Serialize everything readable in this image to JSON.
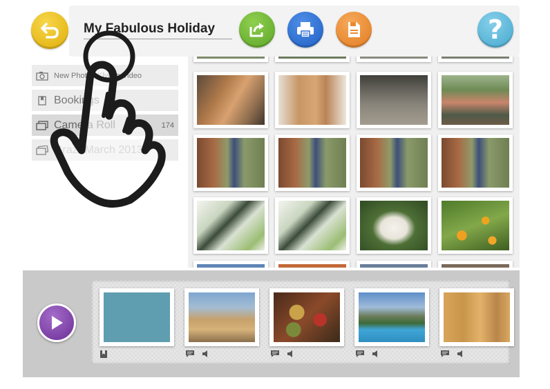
{
  "header": {
    "title": "My Fabulous Holiday"
  },
  "sidebar": {
    "items": [
      {
        "label": "New Photo / Klynka Video",
        "icon": "camera-icon"
      },
      {
        "label": "Bookings",
        "icon": "bookmark-icon"
      },
      {
        "label": "Camera Roll",
        "count": "174",
        "icon": "photos-icon",
        "selected": true
      },
      {
        "label": "Graz- March 2013",
        "icon": "album-icon"
      }
    ]
  },
  "photos": [
    {
      "subject": "orange cat"
    },
    {
      "subject": "orange cat close-up"
    },
    {
      "subject": "cat lying on patio"
    },
    {
      "subject": "group of friends"
    },
    {
      "subject": "woman by tree"
    },
    {
      "subject": "woman by tree"
    },
    {
      "subject": "woman by tree"
    },
    {
      "subject": "woman by tree"
    },
    {
      "subject": "building sketch"
    },
    {
      "subject": "building sketch"
    },
    {
      "subject": "white goat"
    },
    {
      "subject": "orange tree"
    }
  ],
  "storyboard": {
    "cards": [
      {
        "subject": "blank page",
        "icons": [
          "bookmark-icon"
        ]
      },
      {
        "subject": "coastal town",
        "icons": [
          "caption-icon",
          "audio-icon"
        ]
      },
      {
        "subject": "market food",
        "icons": [
          "caption-icon",
          "audio-icon"
        ]
      },
      {
        "subject": "swimming pool",
        "icons": [
          "caption-icon",
          "audio-icon"
        ]
      },
      {
        "subject": "yellow buildings",
        "icons": [
          "caption-icon",
          "audio-icon"
        ]
      }
    ]
  },
  "colors": {
    "back": "#e7bb16",
    "share": "#6cb531",
    "print": "#2f6fd6",
    "save": "#eb8a2e",
    "help": "#57b6da",
    "play": "#7b3aa6"
  }
}
